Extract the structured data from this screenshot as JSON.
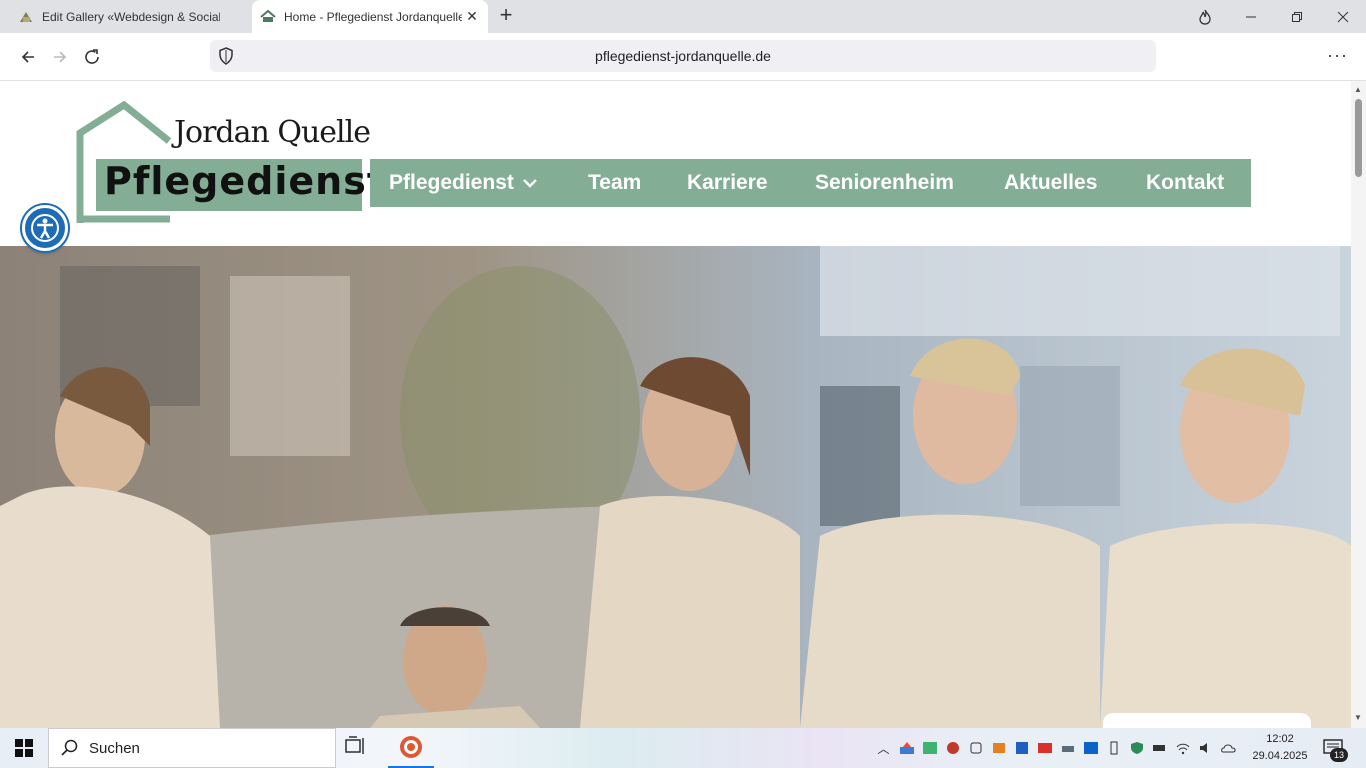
{
  "browser": {
    "tabs": [
      {
        "title": "Edit Gallery «Webdesign & Social-M",
        "active": false
      },
      {
        "title": "Home - Pflegedienst Jordanquelle",
        "active": true
      }
    ],
    "url": "pflegedienst-jordanquelle.de"
  },
  "site": {
    "logo_top": "Jordan Quelle",
    "logo_main": "Pflegedienst",
    "nav": [
      {
        "label": "Pflegedienst",
        "has_dropdown": true
      },
      {
        "label": "Team"
      },
      {
        "label": "Karriere"
      },
      {
        "label": "Seniorenheim"
      },
      {
        "label": "Aktuelles"
      },
      {
        "label": "Kontakt"
      }
    ],
    "brand_color": "#84ad96"
  },
  "taskbar": {
    "search_label": "Suchen",
    "time": "12:02",
    "date": "29.04.2025",
    "notification_count": "13"
  }
}
